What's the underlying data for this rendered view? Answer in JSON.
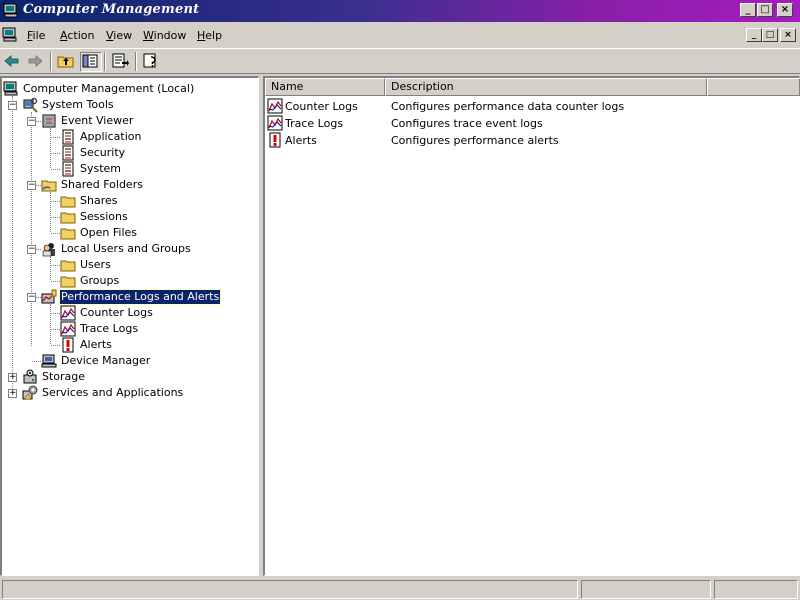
{
  "window": {
    "title": "Computer Management",
    "controls": {
      "minimize": "_",
      "maximize": "□",
      "close": "×"
    }
  },
  "menu": {
    "items": [
      {
        "label": "File",
        "accel": "F",
        "rest": "ile"
      },
      {
        "label": "Action",
        "accel": "A",
        "rest": "ction"
      },
      {
        "label": "View",
        "accel": "V",
        "rest": "iew"
      },
      {
        "label": "Window",
        "accel": "W",
        "rest": "indow"
      },
      {
        "label": "Help",
        "accel": "H",
        "rest": "elp"
      }
    ]
  },
  "toolbar": {
    "buttons": [
      "back-arrow-icon",
      "forward-arrow-icon",
      "up-one-level-icon",
      "show-hide-tree-icon",
      "export-list-icon",
      "help-icon"
    ]
  },
  "tree": {
    "root": "Computer Management (Local)",
    "system_tools": "System Tools",
    "event_viewer": "Event Viewer",
    "application": "Application",
    "security": "Security",
    "system": "System",
    "shared_folders": "Shared Folders",
    "shares": "Shares",
    "sessions": "Sessions",
    "open_files": "Open Files",
    "local_users_groups": "Local Users and Groups",
    "users": "Users",
    "groups": "Groups",
    "perf_logs_alerts": "Performance Logs and Alerts",
    "counter_logs": "Counter Logs",
    "trace_logs": "Trace Logs",
    "alerts": "Alerts",
    "device_manager": "Device Manager",
    "storage": "Storage",
    "services_apps": "Services and Applications",
    "expand_symbol": "+",
    "collapse_symbol": "−"
  },
  "detail": {
    "columns": {
      "name": "Name",
      "description": "Description"
    },
    "rows": [
      {
        "name": "Counter Logs",
        "description": "Configures performance data counter logs"
      },
      {
        "name": "Trace Logs",
        "description": "Configures trace event logs"
      },
      {
        "name": "Alerts",
        "description": "Configures performance alerts"
      }
    ]
  },
  "colors": {
    "title_gradient_start": "#0a246a",
    "title_gradient_end": "#a61cc0",
    "selection": "#0a246a",
    "face": "#d4d0c8"
  }
}
